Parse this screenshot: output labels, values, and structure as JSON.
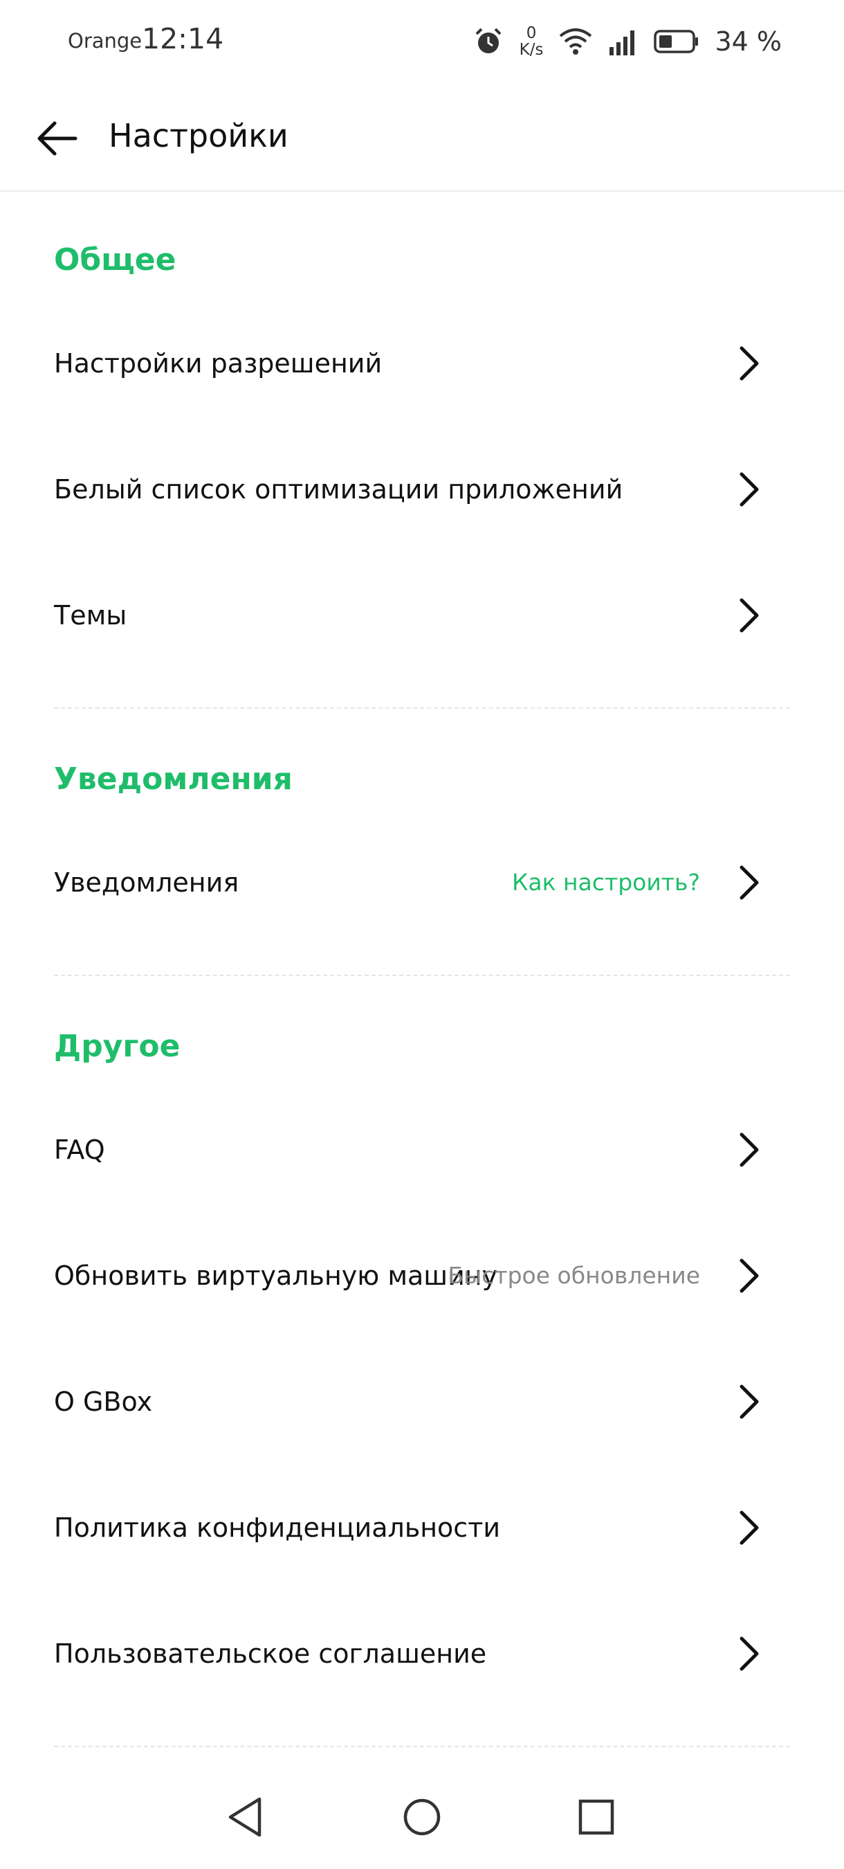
{
  "status": {
    "carrier": "Orange",
    "time": "12:14",
    "net_speed_value": "0",
    "net_speed_unit": "K/s",
    "battery": "34 %"
  },
  "appbar": {
    "title": "Настройки"
  },
  "sections": {
    "general": {
      "title": "Общее",
      "items": [
        "Настройки разрешений",
        "Белый список оптимизации приложений",
        "Темы"
      ]
    },
    "notifications": {
      "title": "Уведомления",
      "item": "Уведомления",
      "hint": "Как настроить?"
    },
    "other": {
      "title": "Другое",
      "items": [
        "FAQ",
        "Обновить виртуальную машину",
        "О GBox",
        "Политика конфиденциальности",
        "Пользовательское соглашение"
      ],
      "update_hint": "Быстрое обновление"
    }
  },
  "colors": {
    "accent": "#1fbd6a",
    "text": "#111111",
    "hint_gray": "#888888"
  },
  "icons": {
    "back": "arrow-left-icon",
    "chevron": "chevron-right-icon",
    "nav": [
      "triangle-back-icon",
      "circle-home-icon",
      "square-recents-icon"
    ]
  }
}
